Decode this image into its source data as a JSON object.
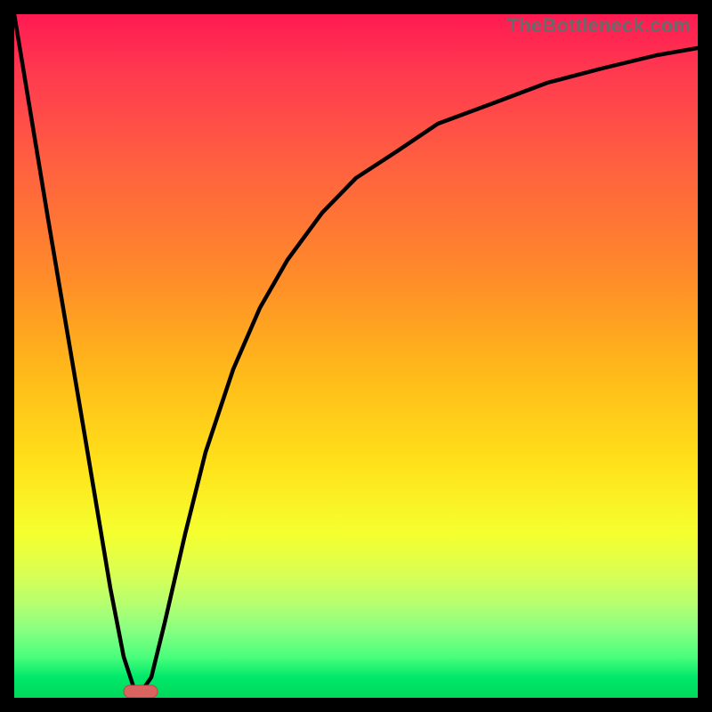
{
  "attribution": "TheBottleneck.com",
  "colors": {
    "page_bg": "#000000",
    "curve": "#000000",
    "marker_fill": "#d9635f",
    "marker_stroke": "#b24a47"
  },
  "chart_data": {
    "type": "line",
    "title": "",
    "xlabel": "",
    "ylabel": "",
    "xlim": [
      0,
      100
    ],
    "ylim": [
      0,
      100
    ],
    "series": [
      {
        "name": "bottleneck-curve",
        "x": [
          0,
          5,
          10,
          14,
          16,
          18,
          20,
          22,
          25,
          28,
          32,
          36,
          40,
          45,
          50,
          56,
          62,
          70,
          78,
          86,
          94,
          100
        ],
        "y": [
          100,
          70,
          40,
          16,
          6,
          0,
          3,
          11,
          24,
          36,
          48,
          57,
          64,
          71,
          76,
          80,
          84,
          87,
          90,
          92,
          94,
          95
        ]
      }
    ],
    "marker": {
      "x_range": [
        16,
        20
      ],
      "y": 0,
      "label": "optimal-point"
    }
  }
}
